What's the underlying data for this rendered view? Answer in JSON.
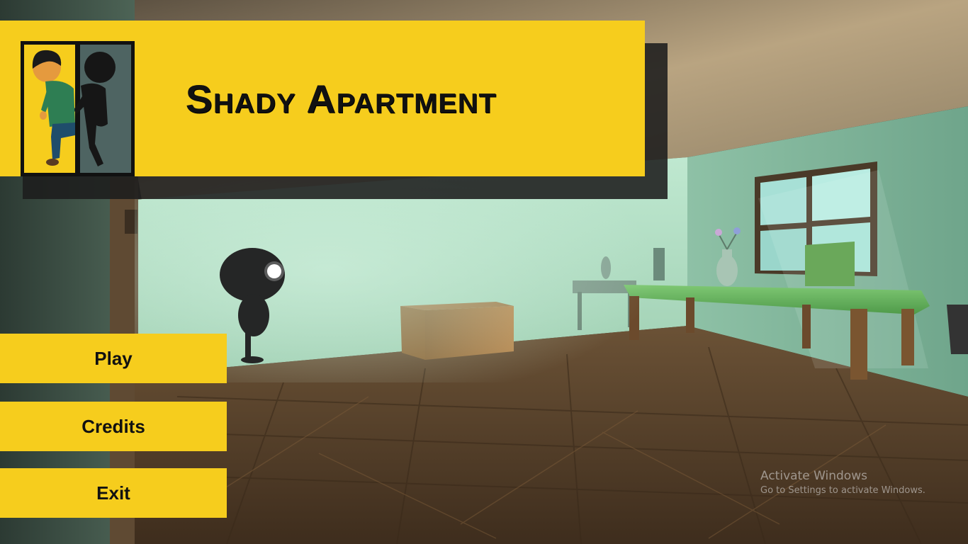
{
  "game": {
    "title": "Shady Apartment"
  },
  "menu": {
    "items": [
      {
        "label": "Play"
      },
      {
        "label": "Credits"
      },
      {
        "label": "Exit"
      }
    ]
  },
  "watermark": {
    "title": "Activate Windows",
    "subtitle": "Go to Settings to activate Windows."
  },
  "colors": {
    "accent": "#f6cd1d",
    "text": "#111111",
    "wall": "#b6e3c9",
    "floor": "#5a4028"
  },
  "icons": {
    "logo": "boy-and-shadow-logo"
  }
}
